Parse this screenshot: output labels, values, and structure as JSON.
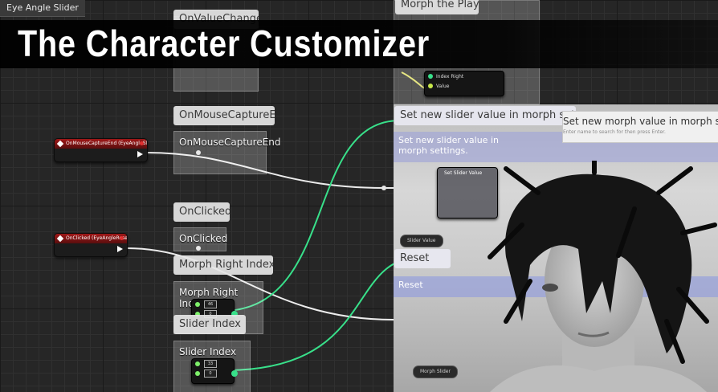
{
  "tab": {
    "label": "Eye Angle Slider"
  },
  "banner": {
    "title": "The Character Customizer"
  },
  "comments": {
    "top_bubble": "OnValueChanged",
    "morph_player": "Morph the Player",
    "mouse_capture_end_bubble": "OnMouseCaptureEnd",
    "mouse_capture_end_box": "OnMouseCaptureEnd",
    "on_clicked_bubble": "OnClicked",
    "on_clicked_box": "OnClicked",
    "morph_right_bubble": "Morph Right Index",
    "morph_right_box": "Morph Right Index",
    "slider_index_bubble": "Slider Index",
    "slider_index_box": "Slider Index",
    "set_slider_bubble": "Set new slider value in morph settings.",
    "set_slider_box": "Set new slider value in morph settings.",
    "reset_bubble": "Reset",
    "reset_box": "Reset"
  },
  "events": {
    "capture_end": "OnMouseCaptureEnd (EyeAngleSlider)",
    "clicked": "OnClicked (EyeAngleReset)"
  },
  "morph_node": {
    "pin1": "Index Right",
    "pin2": "Value"
  },
  "morph_right_node": {
    "v1": "46",
    "v2": "0"
  },
  "slider_index_node": {
    "v1": "33",
    "v2": "0"
  },
  "set_slider_node": {
    "title": "Set Slider Value"
  },
  "slider_value_pill": "Slider Value",
  "morph_pill": "Morph Slider",
  "search": {
    "title": "Set new morph value in morph settings",
    "hint": "Enter name to search for then press Enter."
  },
  "colors": {
    "accent_wire": "#38e08a",
    "event_header": "#a01818",
    "banner_bg": "#000000"
  }
}
